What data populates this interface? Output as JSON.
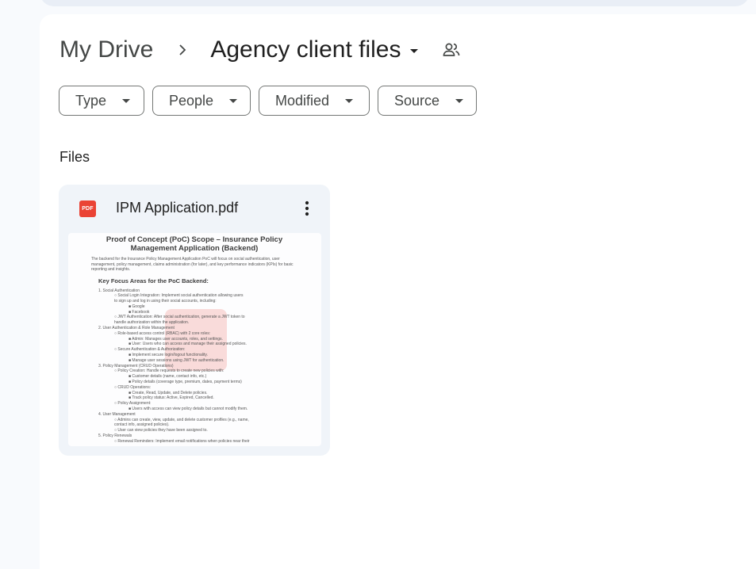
{
  "breadcrumb": {
    "root": "My Drive",
    "current": "Agency client files"
  },
  "icons": {
    "separator": "chevron-right-icon",
    "shared": "shared-people-icon",
    "pdf": "pdf-icon",
    "more": "more-vert-icon"
  },
  "filters": [
    {
      "label": "Type"
    },
    {
      "label": "People"
    },
    {
      "label": "Modified"
    },
    {
      "label": "Source"
    }
  ],
  "section": {
    "files_label": "Files"
  },
  "file": {
    "name": "IPM Application.pdf",
    "icon_text": "PDF",
    "preview": {
      "title": "Proof of Concept (PoC) Scope – Insurance Policy Management Application (Backend)",
      "intro": "The backend for the Insurance Policy Management Application PoC will focus on social authentication, user management, policy management, claims administration (for later), and key performance indicators (KPIs) for basic reporting and insights.",
      "heading": "Key Focus Areas for the PoC Backend:",
      "lines": [
        {
          "level": 1,
          "text": "1.  Social Authentication"
        },
        {
          "level": 2,
          "text": "○  Social Login Integration: Implement social authentication allowing users"
        },
        {
          "level": 2,
          "text": "    to sign up and log in using their social accounts, including:"
        },
        {
          "level": 3,
          "text": "■  Google"
        },
        {
          "level": 3,
          "text": "■  Facebook"
        },
        {
          "level": 2,
          "text": "○  JWT Authentication: After social authentication, generate a JWT token to"
        },
        {
          "level": 2,
          "text": "    handle authorization within the application."
        },
        {
          "level": 1,
          "text": "2.  User Authentication & Role Management"
        },
        {
          "level": 2,
          "text": "○  Role-based access control (RBAC) with 2 core roles:"
        },
        {
          "level": 3,
          "text": "■  Admin: Manages user accounts, roles, and settings."
        },
        {
          "level": 3,
          "text": "■  User: Users who can access and manage their assigned policies."
        },
        {
          "level": 2,
          "text": "○  Secure Authentication & Authorization:"
        },
        {
          "level": 3,
          "text": "■  Implement secure login/logout functionality."
        },
        {
          "level": 3,
          "text": "■  Manage user sessions using JWT for authentication."
        },
        {
          "level": 1,
          "text": "3.  Policy Management (CRUD Operations)"
        },
        {
          "level": 2,
          "text": "○  Policy Creation: Handle requests to create new policies with:"
        },
        {
          "level": 3,
          "text": "■  Customer details (name, contact info, etc.)"
        },
        {
          "level": 3,
          "text": "■  Policy details (coverage type, premium, dates, payment terms)"
        },
        {
          "level": 2,
          "text": "○  CRUD Operations:"
        },
        {
          "level": 3,
          "text": "■  Create, Read, Update, and Delete policies."
        },
        {
          "level": 3,
          "text": "■  Track policy status: Active, Expired, Cancelled."
        },
        {
          "level": 2,
          "text": "○  Policy Assignment:"
        },
        {
          "level": 3,
          "text": "■  Users with access can view policy details but cannot modify them."
        },
        {
          "level": 1,
          "text": "4.  User Management"
        },
        {
          "level": 2,
          "text": "○  Admins can create, view, update, and delete customer profiles (e.g., name,"
        },
        {
          "level": 2,
          "text": "    contact info, assigned policies)."
        },
        {
          "level": 2,
          "text": "○  User can view policies they have been assigned to."
        },
        {
          "level": 1,
          "text": "5.  Policy Renewals"
        },
        {
          "level": 2,
          "text": "○  Renewal Reminders: Implement email notifications when policies near their"
        }
      ]
    }
  }
}
